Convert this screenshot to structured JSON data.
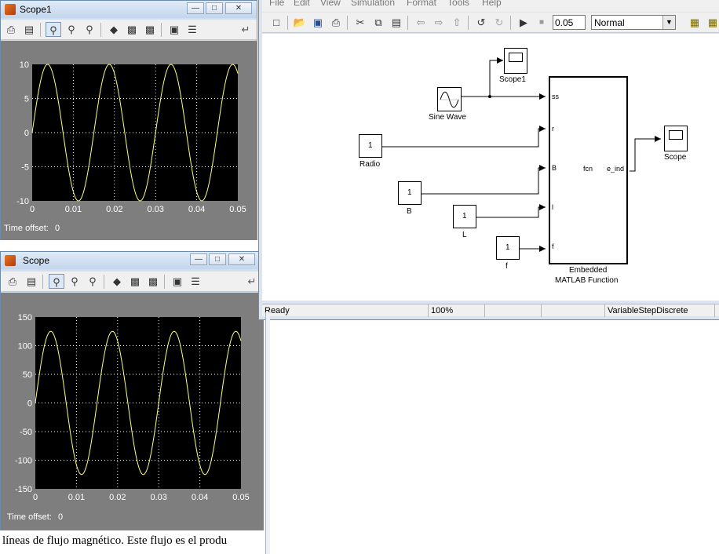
{
  "scope1_window": {
    "title": "Scope1",
    "time_offset_label": "Time offset:",
    "time_offset_value": "0",
    "y_ticks": [
      "10",
      "5",
      "0",
      "-5",
      "-10"
    ],
    "x_ticks": [
      "0",
      "0.01",
      "0.02",
      "0.03",
      "0.04",
      "0.05"
    ]
  },
  "scope_window": {
    "title": "Scope",
    "time_offset_label": "Time offset:",
    "time_offset_value": "0",
    "y_ticks": [
      "150",
      "100",
      "50",
      "0",
      "-50",
      "-100",
      "-150"
    ],
    "x_ticks": [
      "0",
      "0.01",
      "0.02",
      "0.03",
      "0.04",
      "0.05"
    ]
  },
  "model_window": {
    "menu": [
      "File",
      "Edit",
      "View",
      "Simulation",
      "Format",
      "Tools",
      "Help"
    ],
    "stop_time": "0.05",
    "sim_mode": "Normal",
    "blocks": {
      "scope1": "Scope1",
      "sine": "Sine Wave",
      "radio": "Radio",
      "radio_value": "1",
      "b": "B",
      "b_value": "1",
      "l": "L",
      "l_value": "1",
      "f": "f",
      "f_value": "1",
      "scope": "Scope",
      "fcn_name": "fcn",
      "fcn_out": "e_ind",
      "fcn_caption_line1": "Embedded",
      "fcn_caption_line2": "MATLAB Function",
      "ports_in": [
        "ss",
        "r",
        "B",
        "l",
        "f"
      ]
    },
    "status": {
      "state": "Ready",
      "zoom": "100%",
      "solver": "VariableStepDiscrete"
    }
  },
  "document_text": "líneas de flujo magnético. Este flujo es el produ",
  "colors": {
    "trace": "#ffff80",
    "plot_bg": "#000000",
    "scope_bg": "#7e7e7e",
    "window_frame": "#cfdff0"
  },
  "chart_data": [
    {
      "type": "line",
      "title": "",
      "xlabel": "",
      "ylabel": "",
      "xlim": [
        0,
        0.05
      ],
      "ylim": [
        -10,
        10
      ],
      "grid": true,
      "series": [
        {
          "amplitude": 10,
          "frequency_hz": 66.67,
          "x_start": 0,
          "x_end": 0.05
        }
      ]
    },
    {
      "type": "line",
      "title": "",
      "xlabel": "",
      "ylabel": "",
      "xlim": [
        0,
        0.05
      ],
      "ylim": [
        -150,
        150
      ],
      "grid": true,
      "series": [
        {
          "amplitude": 125,
          "frequency_hz": 66.67,
          "x_start": 0,
          "x_end": 0.05
        }
      ]
    }
  ]
}
